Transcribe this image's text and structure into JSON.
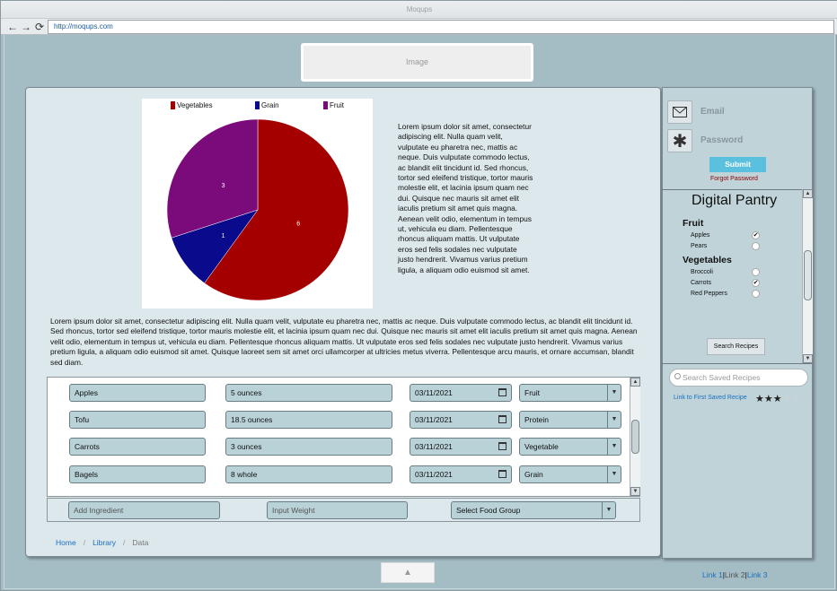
{
  "browser": {
    "title": "Moqups",
    "url": "http://moqups.com",
    "back_icon": "←",
    "forward_icon": "→",
    "reload_icon": "⟳"
  },
  "header": {
    "image_label": "Image"
  },
  "chart_data": {
    "type": "pie",
    "categories": [
      "Vegetables",
      "Grain",
      "Fruit"
    ],
    "values": [
      6,
      1,
      3
    ],
    "colors": [
      "#a50000",
      "#0a0a8c",
      "#7b0a7b"
    ],
    "title": "",
    "legend": "top"
  },
  "side_text": "Lorem ipsum dolor sit amet, consectetur adipiscing elit. Nulla quam velit, vulputate eu pharetra nec, mattis ac neque. Duis vulputate commodo lectus, ac blandit elit tincidunt id. Sed rhoncus, tortor sed eleifend tristique, tortor mauris molestie elit, et lacinia ipsum quam nec dui. Quisque nec mauris sit amet elit iaculis pretium sit amet quis magna. Aenean velit odio, elementum in tempus ut, vehicula eu diam. Pellentesque rhoncus aliquam mattis. Ut vulputate eros sed felis sodales nec vulputate justo hendrerit. Vivamus varius pretium ligula, a aliquam odio euismod sit amet.",
  "paragraph": "Lorem ipsum dolor sit amet, consectetur adipiscing elit. Nulla quam velit, vulputate eu pharetra nec, mattis ac neque. Duis vulputate commodo lectus, ac blandit elit tincidunt id. Sed rhoncus, tortor sed eleifend tristique, tortor mauris molestie elit, et lacinia ipsum quam nec dui. Quisque nec mauris sit amet elit iaculis pretium sit amet quis magna. Aenean velit odio, elementum in tempus ut, vehicula eu diam. Pellentesque rhoncus aliquam mattis. Ut vulputate eros sed felis sodales nec vulputate justo hendrerit. Vivamus varius pretium ligula, a aliquam odio euismod sit amet. Quisque laoreet sem sit amet orci ullamcorper at ultricies metus viverra. Pellentesque arcu mauris, et ornare accumsan, blandit sed diam.",
  "ingredients": [
    {
      "name": "Apples",
      "weight": "5 ounces",
      "date": "03/11/2021",
      "group": "Fruit"
    },
    {
      "name": "Tofu",
      "weight": "18.5 ounces",
      "date": "03/11/2021",
      "group": "Protein"
    },
    {
      "name": "Carrots",
      "weight": "3 ounces",
      "date": "03/11/2021",
      "group": "Vegetable"
    },
    {
      "name": "Bagels",
      "weight": "8 whole",
      "date": "03/11/2021",
      "group": "Grain"
    }
  ],
  "add_row": {
    "ingredient_placeholder": "Add Ingredient",
    "weight_placeholder": "Input Weight",
    "group_placeholder": "Select Food Group"
  },
  "breadcrumb": [
    "Home",
    "Library",
    "Data"
  ],
  "login": {
    "email_label": "Email",
    "password_label": "Password",
    "submit_label": "Submit",
    "forgot_label": "Forgot Password"
  },
  "pantry": {
    "title": "Digital Pantry",
    "categories": [
      {
        "name": "Fruit",
        "items": [
          {
            "label": "Apples",
            "checked": true
          },
          {
            "label": "Pears",
            "checked": false
          }
        ]
      },
      {
        "name": "Vegetables",
        "items": [
          {
            "label": "Broccoli",
            "checked": false
          },
          {
            "label": "Carrots",
            "checked": true
          },
          {
            "label": "Red Peppers",
            "checked": false
          }
        ]
      }
    ],
    "search_button": "Search Recipes"
  },
  "saved": {
    "search_placeholder": "Search Saved Recipes",
    "link_label": "Link to First Saved Recipe",
    "rating": 3,
    "rating_max": 5
  },
  "footer": {
    "links": [
      "Link 1",
      "Link 2",
      "Link 3"
    ],
    "active_index": 1,
    "image_icon": "▲"
  }
}
